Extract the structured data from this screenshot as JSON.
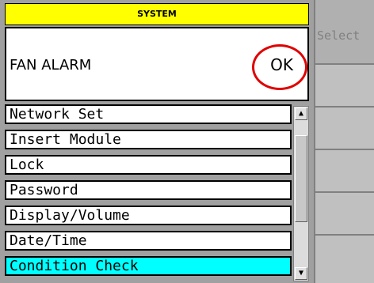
{
  "header": {
    "title": "SYSTEM"
  },
  "alarm": {
    "label": "FAN ALARM",
    "value": "OK"
  },
  "menu": {
    "items": [
      {
        "label": "Network Set"
      },
      {
        "label": "Insert Module"
      },
      {
        "label": "Lock"
      },
      {
        "label": "Password"
      },
      {
        "label": "Display/Volume"
      },
      {
        "label": "Date/Time"
      },
      {
        "label": "Condition Check"
      }
    ],
    "selected_index": 6
  },
  "scrollbar": {
    "up_icon": "arrow-up-icon",
    "down_icon": "arrow-down-icon"
  },
  "side_panel": {
    "select_label": "Select"
  },
  "colors": {
    "header_bg": "#ffff00",
    "selected_bg": "#00ffff",
    "highlight": "#e00000"
  }
}
